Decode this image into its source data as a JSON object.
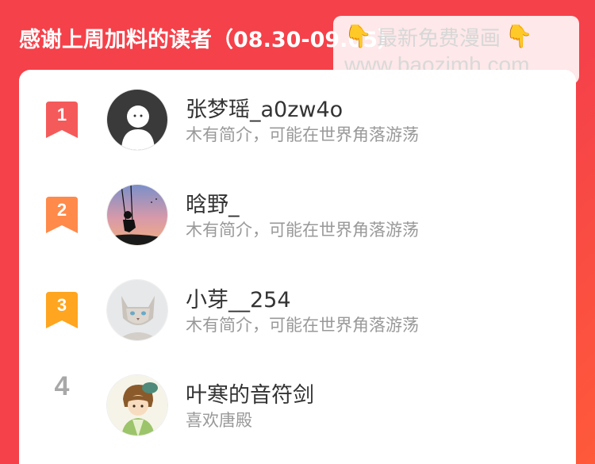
{
  "header": {
    "title": "感谢上周加料的读者（08.30-09.05）"
  },
  "watermark": {
    "line1": "最新免费漫画",
    "hand_icon": "👇",
    "line2": "www.baozimh.com"
  },
  "readers": [
    {
      "rank": "1",
      "name": "张梦瑶_a0zw4o",
      "bio": "木有简介，可能在世界角落游荡",
      "badge_color": "#f55a5a",
      "avatar": "ghost-avatar"
    },
    {
      "rank": "2",
      "name": "晗野_",
      "bio": "木有简介，可能在世界角落游荡",
      "badge_color": "#ff8a4a",
      "avatar": "swing-silhouette-avatar"
    },
    {
      "rank": "3",
      "name": "小芽__254",
      "bio": "木有简介，可能在世界角落游荡",
      "badge_color": "#ffa51f",
      "avatar": "cat-avatar"
    },
    {
      "rank": "4",
      "name": "叶寒的音符剑",
      "bio": "喜欢唐殿",
      "badge_color": "",
      "avatar": "anime-boy-avatar"
    }
  ]
}
